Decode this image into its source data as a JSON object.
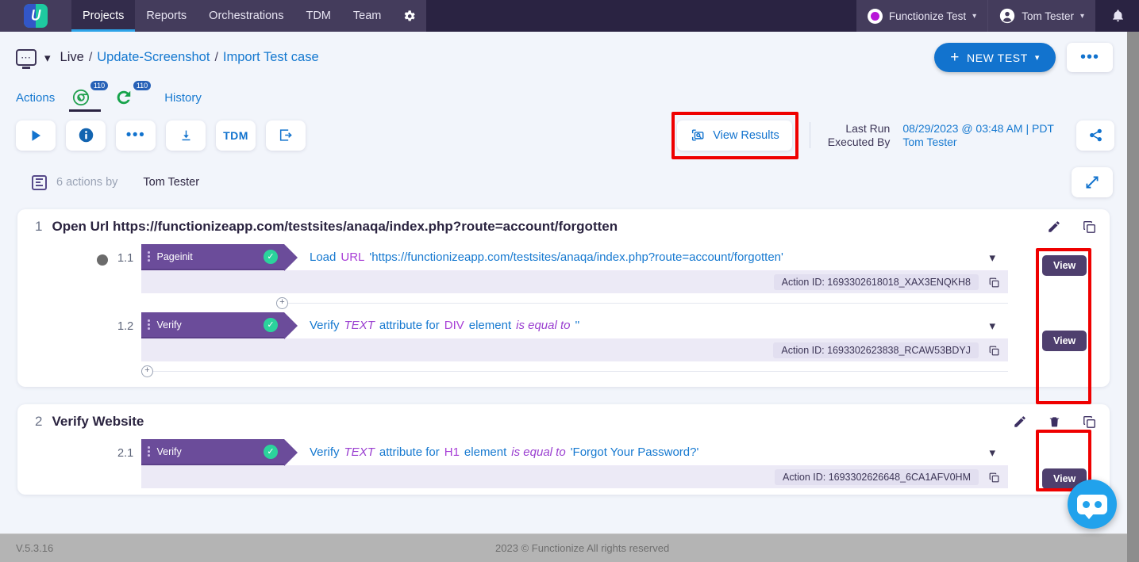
{
  "topnav": {
    "logo_label": "functionize-logo",
    "items": [
      {
        "label": "Projects",
        "active": true
      },
      {
        "label": "Reports",
        "active": false
      },
      {
        "label": "Orchestrations",
        "active": false
      },
      {
        "label": "TDM",
        "active": false
      },
      {
        "label": "Team",
        "active": false
      }
    ],
    "gear_icon": "gear-icon",
    "workspace": "Functionize Test",
    "user": "Tom Tester",
    "bell_icon": "bell-icon",
    "accent": "#2da3e8",
    "bg": "#2a2342"
  },
  "breadcrumb": {
    "monitor_icon": "monitor-icon",
    "chevron": "⌄",
    "env": "Live",
    "sep": "/",
    "project": "Update-Screenshot",
    "test": "Import Test case",
    "new_test_label": "NEW TEST",
    "new_test_plus": "+",
    "new_test_chevron": "▾",
    "more_label": "•••"
  },
  "subtabs": {
    "actions": "Actions",
    "chrome_badge": "110",
    "mobile_badge": "110",
    "history": "History"
  },
  "toolbar": {
    "buttons": [
      {
        "name": "run-button",
        "label": "▶"
      },
      {
        "name": "info-button",
        "label": "i"
      },
      {
        "name": "more-button",
        "label": "•••"
      },
      {
        "name": "download-button",
        "label": "⬇"
      },
      {
        "name": "tdm-button",
        "label": "TDM"
      },
      {
        "name": "export-button",
        "label": "➡"
      }
    ],
    "view_results": "View Results",
    "last_run_label": "Last Run",
    "last_run_value": "08/29/2023 @ 03:48 AM | PDT",
    "executed_by_label": "Executed By",
    "executed_by_value": "Tom Tester",
    "share_icon": "share-icon",
    "highlight_color": "#ef0000"
  },
  "actions_header": {
    "list_icon": "list-icon",
    "count_text": "6 actions by",
    "author": "Tom Tester",
    "expand_icon": "expand-icon"
  },
  "sections": [
    {
      "num": "1",
      "title": "Open Url https://functionizeapp.com/testsites/anaqa/index.php?route=account/forgotten",
      "icons": [
        "pencil-icon",
        "copy-icon"
      ],
      "steps": [
        {
          "bullet": true,
          "num": "1.1",
          "tag": "Pageinit",
          "status": "✓",
          "desc_parts": [
            {
              "text": "Load",
              "style": "link"
            },
            {
              "text": "URL",
              "style": "violet"
            },
            {
              "text": "'https://functionizeapp.com/testsites/anaqa/index.php?route=account/forgotten'",
              "style": "link"
            }
          ],
          "action_id": "Action ID: 1693302618018_XAX3ENQKH8",
          "copy_icon": "copy-icon",
          "view_label": "View"
        },
        {
          "bullet": false,
          "num": "1.2",
          "tag": "Verify",
          "status": "✓",
          "desc_parts": [
            {
              "text": "Verify",
              "style": "link"
            },
            {
              "text": "TEXT",
              "style": "italic-purple"
            },
            {
              "text": "attribute for",
              "style": "link"
            },
            {
              "text": "DIV",
              "style": "violet"
            },
            {
              "text": "element",
              "style": "link"
            },
            {
              "text": "is equal to",
              "style": "italic-purple"
            },
            {
              "text": "''",
              "style": "link"
            }
          ],
          "action_id": "Action ID: 1693302623838_RCAW53BDYJ",
          "copy_icon": "copy-icon",
          "view_label": "View"
        }
      ]
    },
    {
      "num": "2",
      "title": "Verify Website",
      "icons": [
        "pencil-icon",
        "trash-icon",
        "copy-icon"
      ],
      "steps": [
        {
          "bullet": false,
          "num": "2.1",
          "tag": "Verify",
          "status": "✓",
          "desc_parts": [
            {
              "text": "Verify",
              "style": "link"
            },
            {
              "text": "TEXT",
              "style": "italic-purple"
            },
            {
              "text": "attribute for",
              "style": "link"
            },
            {
              "text": "H1",
              "style": "violet"
            },
            {
              "text": "element",
              "style": "link"
            },
            {
              "text": "is equal to",
              "style": "italic-purple"
            },
            {
              "text": "'Forgot Your Password?'",
              "style": "link"
            }
          ],
          "action_id": "Action ID: 1693302626648_6CA1AFV0HM",
          "copy_icon": "copy-icon",
          "view_label": "View"
        }
      ]
    }
  ],
  "footer": {
    "version": "V.5.3.16",
    "copyright": "2023 © Functionize All rights reserved"
  },
  "chatbot": {
    "icon": "chat-bot-icon"
  }
}
